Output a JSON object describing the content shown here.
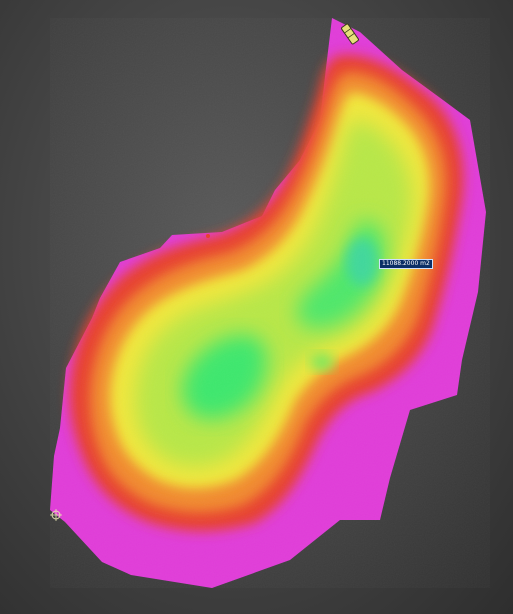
{
  "viewer": {
    "measurement_label": "11088.2000 m2",
    "colors": {
      "background_center": "#5a5a5a",
      "background_edge": "#2e2e2e",
      "terrain_base": "#e13cd9",
      "elevation_high": "#e8412f",
      "elevation_mid": "#f2e83a",
      "elevation_low": "#3ee86d",
      "label_background": "#0a2f66"
    },
    "icons": [
      "survey-marker-icon",
      "ground-control-point-icon"
    ]
  }
}
